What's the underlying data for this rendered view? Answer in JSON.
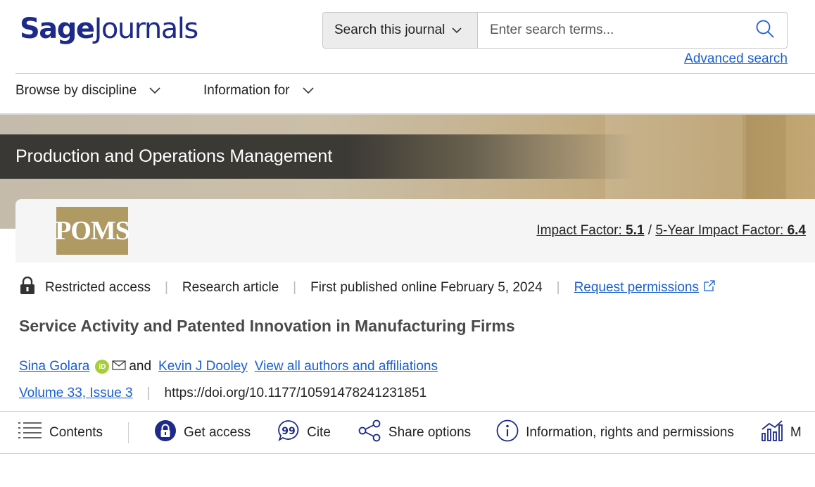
{
  "header": {
    "logo_sage": "Sage",
    "logo_journals": "Journals",
    "search_scope": "Search this journal",
    "search_placeholder": "Enter search terms...",
    "advanced_search": "Advanced search"
  },
  "nav": [
    {
      "label": "Browse by discipline"
    },
    {
      "label": "Information for"
    }
  ],
  "journal": {
    "title": "Production and Operations Management",
    "logo_text": "POMS",
    "impact_label": "Impact Factor: ",
    "impact_value": "5.1",
    "five_year_label": "5-Year Impact Factor: ",
    "five_year_value": "6.4"
  },
  "article": {
    "access": "Restricted access",
    "type": "Research article",
    "published": "First published online February 5, 2024",
    "permissions": "Request permissions",
    "title": "Service Activity and Patented Innovation in Manufacturing Firms",
    "author1": "Sina Golara",
    "and": "and",
    "author2": "Kevin J Dooley",
    "all_authors": "View all authors and affiliations",
    "volume": "Volume 33, Issue 3",
    "doi": "https://doi.org/10.1177/10591478241231851"
  },
  "toolbar": {
    "contents": "Contents",
    "get_access": "Get access",
    "cite": "Cite",
    "share": "Share options",
    "info": "Information, rights and permissions",
    "metrics": "M"
  },
  "colors": {
    "brand": "#1d2a8a",
    "link": "#1a5fd0",
    "title_bar": "#3a3834",
    "poms_gold": "#b09a64",
    "orcid": "#a6ce39"
  }
}
